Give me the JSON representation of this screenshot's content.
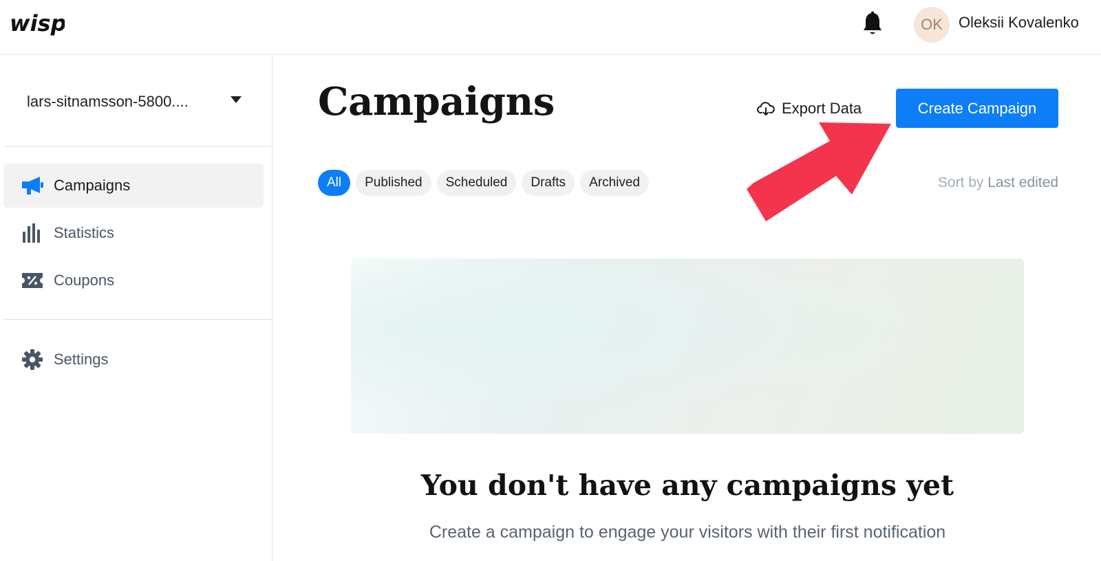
{
  "app": {
    "logo_text": "wisp"
  },
  "header": {
    "notifications_icon": "bell-icon",
    "user": {
      "initials": "OK",
      "name": "Oleksii Kovalenko"
    }
  },
  "sidebar": {
    "workspace": "lars-sitnamsson-5800....",
    "items": [
      {
        "label": "Campaigns",
        "icon": "megaphone-icon",
        "active": true
      },
      {
        "label": "Statistics",
        "icon": "bar-chart-icon",
        "active": false
      },
      {
        "label": "Coupons",
        "icon": "coupon-icon",
        "active": false
      },
      {
        "label": "Settings",
        "icon": "gear-icon",
        "active": false
      }
    ]
  },
  "main": {
    "title": "Campaigns",
    "export_label": "Export Data",
    "create_label": "Create Campaign",
    "filters": [
      "All",
      "Published",
      "Scheduled",
      "Drafts",
      "Archived"
    ],
    "active_filter": "All",
    "sort_prefix": "Sort by",
    "sort_value": "Last edited",
    "empty_title": "You don't have any campaigns yet",
    "empty_subtitle": "Create a campaign to engage your visitors with their first notification"
  },
  "colors": {
    "accent": "#0d7ef8",
    "annotation_arrow": "#f4344c"
  }
}
